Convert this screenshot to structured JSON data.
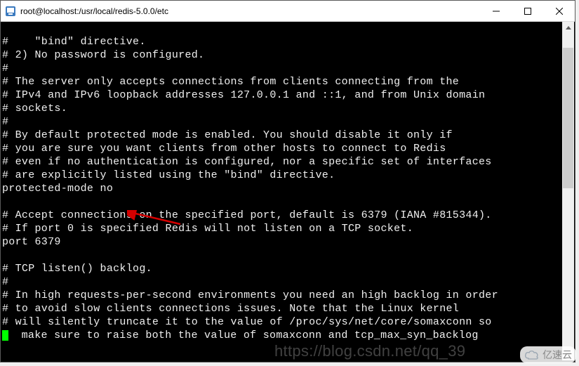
{
  "window": {
    "title": "root@localhost:/usr/local/redis-5.0.0/etc"
  },
  "terminal": {
    "lines": [
      "#    \"bind\" directive.",
      "# 2) No password is configured.",
      "#",
      "# The server only accepts connections from clients connecting from the",
      "# IPv4 and IPv6 loopback addresses 127.0.0.1 and ::1, and from Unix domain",
      "# sockets.",
      "#",
      "# By default protected mode is enabled. You should disable it only if",
      "# you are sure you want clients from other hosts to connect to Redis",
      "# even if no authentication is configured, nor a specific set of interfaces",
      "# are explicitly listed using the \"bind\" directive.",
      "protected-mode no",
      "",
      "# Accept connections on the specified port, default is 6379 (IANA #815344).",
      "# If port 0 is specified Redis will not listen on a TCP socket.",
      "port 6379",
      "",
      "# TCP listen() backlog.",
      "#",
      "# In high requests-per-second environments you need an high backlog in order",
      "# to avoid slow clients connections issues. Note that the Linux kernel",
      "# will silently truncate it to the value of /proc/sys/net/core/somaxconn so",
      "  make sure to raise both the value of somaxconn and tcp_max_syn_backlog"
    ]
  },
  "watermark": "https://blog.csdn.net/qq_39",
  "badge": "亿速云"
}
